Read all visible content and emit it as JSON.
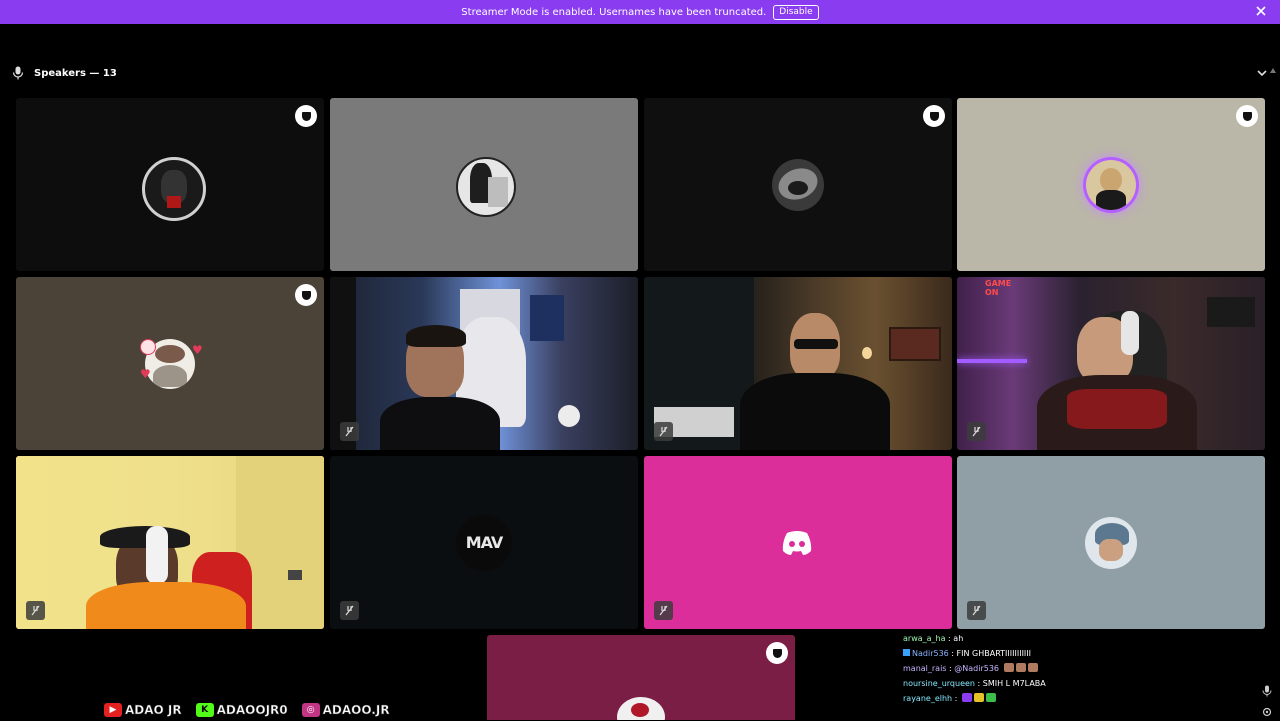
{
  "banner": {
    "message": "Streamer Mode is enabled. Usernames have been truncated.",
    "disable_label": "Disable"
  },
  "voice": {
    "header_label": "Speakers — 13"
  },
  "tiles": [
    {
      "id": "t1",
      "bg": "#0d0d0d",
      "kind": "avatar",
      "avatar_bg": "#c9c9c9",
      "shield": true,
      "muted": false
    },
    {
      "id": "t2",
      "bg": "#7a7a7a",
      "kind": "avatar",
      "avatar_bg": "#d8d8d8",
      "shield": false,
      "muted": false
    },
    {
      "id": "t3",
      "bg": "#0f0f0f",
      "kind": "avatar",
      "avatar_bg": "#6a6a6a",
      "shield": true,
      "muted": false
    },
    {
      "id": "t4",
      "bg": "#bab6a8",
      "kind": "avatar",
      "avatar_bg": "#d8b04a",
      "shield": true,
      "muted": false,
      "glow": "#b460ff"
    },
    {
      "id": "t5",
      "bg": "#4b4338",
      "kind": "avatar",
      "avatar_bg": "#a89582",
      "shield": true,
      "muted": false
    },
    {
      "id": "t6",
      "bg": "#232a3a",
      "kind": "video",
      "muted": true
    },
    {
      "id": "t7",
      "bg": "#2c2520",
      "kind": "video",
      "muted": true
    },
    {
      "id": "t8",
      "bg": "#2a2030",
      "kind": "video",
      "muted": true
    },
    {
      "id": "t9",
      "bg": "#e9d978",
      "kind": "video",
      "muted": true
    },
    {
      "id": "t10",
      "bg": "#0b0e10",
      "kind": "logo",
      "logo_text": "MAV",
      "muted": true
    },
    {
      "id": "t11",
      "bg": "#db2e9a",
      "kind": "discord",
      "muted": true
    },
    {
      "id": "t12",
      "bg": "#909ea6",
      "kind": "avatar",
      "avatar_bg": "#cfd8e0",
      "shield": false,
      "muted": true
    },
    {
      "id": "t13",
      "bg": "#7b1e46",
      "kind": "avatar",
      "avatar_bg": "#e8e8e8",
      "shield": true,
      "muted": false
    }
  ],
  "chat": [
    {
      "user": "arwa_a_ha",
      "sep": " : ",
      "text": "ah",
      "style": "green",
      "emotes": []
    },
    {
      "user": "Nadir536",
      "sep": " : ",
      "text": "FIN GHBARTIIIIIIIIIII",
      "style": "blue",
      "badge": true,
      "emotes": []
    },
    {
      "user": "manal_rais",
      "sep": " : ",
      "text": "@Nadir536",
      "style": "blue",
      "emotes": [
        "#b07a60",
        "#b07a60",
        "#b07a60"
      ]
    },
    {
      "user": "noursine_urqueen",
      "sep": " : ",
      "text": "SMIH L M7LABA",
      "style": "cyan",
      "emotes": []
    },
    {
      "user": "rayane_elhh",
      "sep": " : ",
      "text": "",
      "style": "cyan",
      "emotes": [
        "#8a3cf0",
        "#e6c229",
        "#3cbf4a"
      ]
    }
  ],
  "socials": [
    {
      "platform": "youtube",
      "handle": "ADAO JR",
      "color": "#e52020",
      "glyph": "▶"
    },
    {
      "platform": "kick",
      "handle": "ADAOOJR0",
      "color": "#53fc18",
      "glyph": "K"
    },
    {
      "platform": "instagram",
      "handle": "ADAOO.JR",
      "color": "#c13584",
      "glyph": "◎"
    }
  ]
}
